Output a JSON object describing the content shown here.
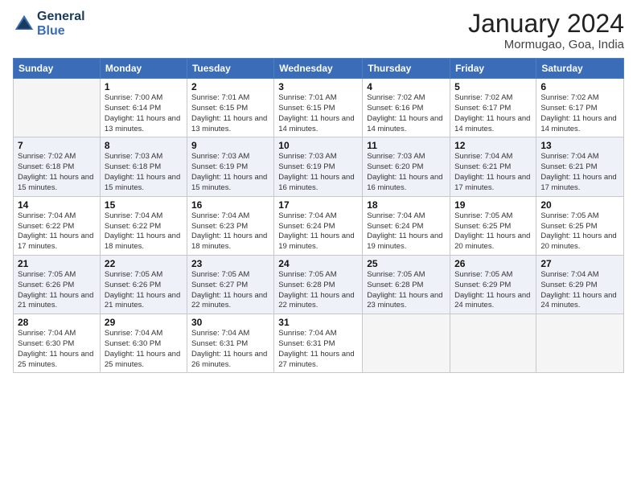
{
  "header": {
    "logo_line1": "General",
    "logo_line2": "Blue",
    "month": "January 2024",
    "location": "Mormugao, Goa, India"
  },
  "days_of_week": [
    "Sunday",
    "Monday",
    "Tuesday",
    "Wednesday",
    "Thursday",
    "Friday",
    "Saturday"
  ],
  "weeks": [
    [
      {
        "day": "",
        "sunrise": "",
        "sunset": "",
        "daylight": ""
      },
      {
        "day": "1",
        "sunrise": "Sunrise: 7:00 AM",
        "sunset": "Sunset: 6:14 PM",
        "daylight": "Daylight: 11 hours and 13 minutes."
      },
      {
        "day": "2",
        "sunrise": "Sunrise: 7:01 AM",
        "sunset": "Sunset: 6:15 PM",
        "daylight": "Daylight: 11 hours and 13 minutes."
      },
      {
        "day": "3",
        "sunrise": "Sunrise: 7:01 AM",
        "sunset": "Sunset: 6:15 PM",
        "daylight": "Daylight: 11 hours and 14 minutes."
      },
      {
        "day": "4",
        "sunrise": "Sunrise: 7:02 AM",
        "sunset": "Sunset: 6:16 PM",
        "daylight": "Daylight: 11 hours and 14 minutes."
      },
      {
        "day": "5",
        "sunrise": "Sunrise: 7:02 AM",
        "sunset": "Sunset: 6:17 PM",
        "daylight": "Daylight: 11 hours and 14 minutes."
      },
      {
        "day": "6",
        "sunrise": "Sunrise: 7:02 AM",
        "sunset": "Sunset: 6:17 PM",
        "daylight": "Daylight: 11 hours and 14 minutes."
      }
    ],
    [
      {
        "day": "7",
        "sunrise": "Sunrise: 7:02 AM",
        "sunset": "Sunset: 6:18 PM",
        "daylight": "Daylight: 11 hours and 15 minutes."
      },
      {
        "day": "8",
        "sunrise": "Sunrise: 7:03 AM",
        "sunset": "Sunset: 6:18 PM",
        "daylight": "Daylight: 11 hours and 15 minutes."
      },
      {
        "day": "9",
        "sunrise": "Sunrise: 7:03 AM",
        "sunset": "Sunset: 6:19 PM",
        "daylight": "Daylight: 11 hours and 15 minutes."
      },
      {
        "day": "10",
        "sunrise": "Sunrise: 7:03 AM",
        "sunset": "Sunset: 6:19 PM",
        "daylight": "Daylight: 11 hours and 16 minutes."
      },
      {
        "day": "11",
        "sunrise": "Sunrise: 7:03 AM",
        "sunset": "Sunset: 6:20 PM",
        "daylight": "Daylight: 11 hours and 16 minutes."
      },
      {
        "day": "12",
        "sunrise": "Sunrise: 7:04 AM",
        "sunset": "Sunset: 6:21 PM",
        "daylight": "Daylight: 11 hours and 17 minutes."
      },
      {
        "day": "13",
        "sunrise": "Sunrise: 7:04 AM",
        "sunset": "Sunset: 6:21 PM",
        "daylight": "Daylight: 11 hours and 17 minutes."
      }
    ],
    [
      {
        "day": "14",
        "sunrise": "Sunrise: 7:04 AM",
        "sunset": "Sunset: 6:22 PM",
        "daylight": "Daylight: 11 hours and 17 minutes."
      },
      {
        "day": "15",
        "sunrise": "Sunrise: 7:04 AM",
        "sunset": "Sunset: 6:22 PM",
        "daylight": "Daylight: 11 hours and 18 minutes."
      },
      {
        "day": "16",
        "sunrise": "Sunrise: 7:04 AM",
        "sunset": "Sunset: 6:23 PM",
        "daylight": "Daylight: 11 hours and 18 minutes."
      },
      {
        "day": "17",
        "sunrise": "Sunrise: 7:04 AM",
        "sunset": "Sunset: 6:24 PM",
        "daylight": "Daylight: 11 hours and 19 minutes."
      },
      {
        "day": "18",
        "sunrise": "Sunrise: 7:04 AM",
        "sunset": "Sunset: 6:24 PM",
        "daylight": "Daylight: 11 hours and 19 minutes."
      },
      {
        "day": "19",
        "sunrise": "Sunrise: 7:05 AM",
        "sunset": "Sunset: 6:25 PM",
        "daylight": "Daylight: 11 hours and 20 minutes."
      },
      {
        "day": "20",
        "sunrise": "Sunrise: 7:05 AM",
        "sunset": "Sunset: 6:25 PM",
        "daylight": "Daylight: 11 hours and 20 minutes."
      }
    ],
    [
      {
        "day": "21",
        "sunrise": "Sunrise: 7:05 AM",
        "sunset": "Sunset: 6:26 PM",
        "daylight": "Daylight: 11 hours and 21 minutes."
      },
      {
        "day": "22",
        "sunrise": "Sunrise: 7:05 AM",
        "sunset": "Sunset: 6:26 PM",
        "daylight": "Daylight: 11 hours and 21 minutes."
      },
      {
        "day": "23",
        "sunrise": "Sunrise: 7:05 AM",
        "sunset": "Sunset: 6:27 PM",
        "daylight": "Daylight: 11 hours and 22 minutes."
      },
      {
        "day": "24",
        "sunrise": "Sunrise: 7:05 AM",
        "sunset": "Sunset: 6:28 PM",
        "daylight": "Daylight: 11 hours and 22 minutes."
      },
      {
        "day": "25",
        "sunrise": "Sunrise: 7:05 AM",
        "sunset": "Sunset: 6:28 PM",
        "daylight": "Daylight: 11 hours and 23 minutes."
      },
      {
        "day": "26",
        "sunrise": "Sunrise: 7:05 AM",
        "sunset": "Sunset: 6:29 PM",
        "daylight": "Daylight: 11 hours and 24 minutes."
      },
      {
        "day": "27",
        "sunrise": "Sunrise: 7:04 AM",
        "sunset": "Sunset: 6:29 PM",
        "daylight": "Daylight: 11 hours and 24 minutes."
      }
    ],
    [
      {
        "day": "28",
        "sunrise": "Sunrise: 7:04 AM",
        "sunset": "Sunset: 6:30 PM",
        "daylight": "Daylight: 11 hours and 25 minutes."
      },
      {
        "day": "29",
        "sunrise": "Sunrise: 7:04 AM",
        "sunset": "Sunset: 6:30 PM",
        "daylight": "Daylight: 11 hours and 25 minutes."
      },
      {
        "day": "30",
        "sunrise": "Sunrise: 7:04 AM",
        "sunset": "Sunset: 6:31 PM",
        "daylight": "Daylight: 11 hours and 26 minutes."
      },
      {
        "day": "31",
        "sunrise": "Sunrise: 7:04 AM",
        "sunset": "Sunset: 6:31 PM",
        "daylight": "Daylight: 11 hours and 27 minutes."
      },
      {
        "day": "",
        "sunrise": "",
        "sunset": "",
        "daylight": ""
      },
      {
        "day": "",
        "sunrise": "",
        "sunset": "",
        "daylight": ""
      },
      {
        "day": "",
        "sunrise": "",
        "sunset": "",
        "daylight": ""
      }
    ]
  ]
}
